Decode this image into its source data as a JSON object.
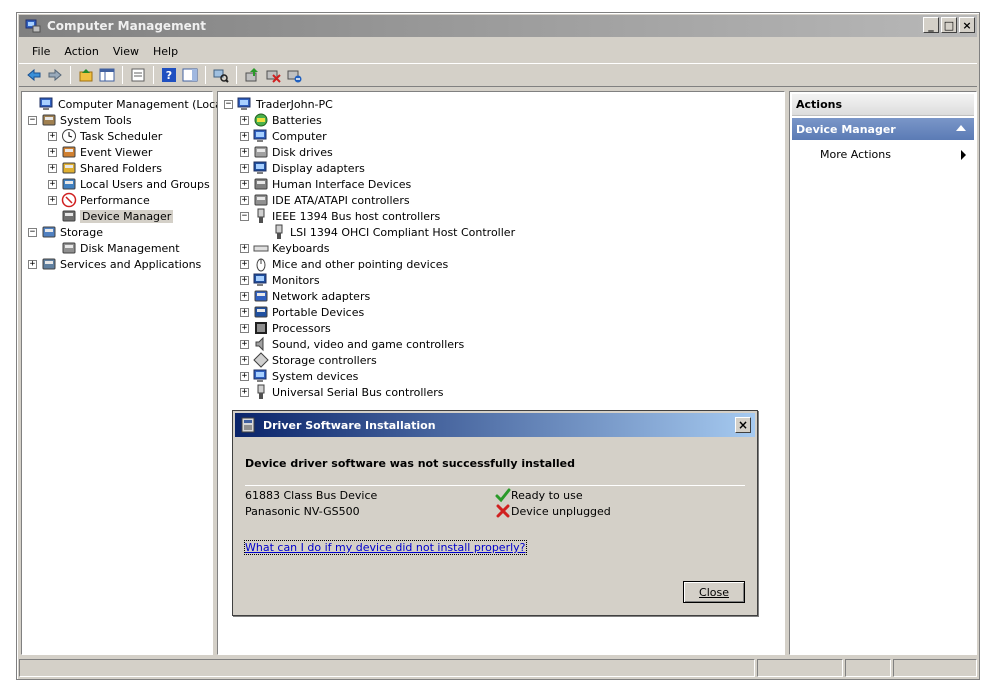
{
  "window": {
    "title": "Computer Management",
    "buttons": {
      "minimize": "_",
      "maximize": "□",
      "close": "×"
    }
  },
  "menu": [
    "File",
    "Action",
    "View",
    "Help"
  ],
  "toolbar": [
    "back-icon",
    "forward-icon",
    "up-icon",
    "show-hide-tree-icon",
    "export-icon",
    "help-icon",
    "action-pane-icon",
    "scan-hardware-icon",
    "update-driver-icon",
    "uninstall-icon",
    "disable-icon"
  ],
  "left_tree": [
    {
      "label": "Computer Management (Local)",
      "indent": 0,
      "expander": "",
      "icon": "computer-mgmt-icon"
    },
    {
      "label": "System Tools",
      "indent": 1,
      "expander": "−",
      "icon": "system-tools-icon"
    },
    {
      "label": "Task Scheduler",
      "indent": 2,
      "expander": "+",
      "icon": "clock-icon"
    },
    {
      "label": "Event Viewer",
      "indent": 2,
      "expander": "+",
      "icon": "event-viewer-icon"
    },
    {
      "label": "Shared Folders",
      "indent": 2,
      "expander": "+",
      "icon": "shared-folder-icon"
    },
    {
      "label": "Local Users and Groups",
      "indent": 2,
      "expander": "+",
      "icon": "users-icon"
    },
    {
      "label": "Performance",
      "indent": 2,
      "expander": "+",
      "icon": "performance-icon"
    },
    {
      "label": "Device Manager",
      "indent": 2,
      "expander": "",
      "icon": "device-manager-icon",
      "selected": true
    },
    {
      "label": "Storage",
      "indent": 1,
      "expander": "−",
      "icon": "storage-icon"
    },
    {
      "label": "Disk Management",
      "indent": 2,
      "expander": "",
      "icon": "disk-icon"
    },
    {
      "label": "Services and Applications",
      "indent": 1,
      "expander": "+",
      "icon": "services-icon"
    }
  ],
  "device_tree": {
    "root": "TraderJohn-PC",
    "categories": [
      {
        "label": "Batteries",
        "expander": "+",
        "icon": "battery-icon"
      },
      {
        "label": "Computer",
        "expander": "+",
        "icon": "computer-icon"
      },
      {
        "label": "Disk drives",
        "expander": "+",
        "icon": "disk-drive-icon"
      },
      {
        "label": "Display adapters",
        "expander": "+",
        "icon": "display-adapter-icon"
      },
      {
        "label": "Human Interface Devices",
        "expander": "+",
        "icon": "hid-icon"
      },
      {
        "label": "IDE ATA/ATAPI controllers",
        "expander": "+",
        "icon": "ide-icon"
      },
      {
        "label": "IEEE 1394 Bus host controllers",
        "expander": "−",
        "icon": "firewire-icon"
      },
      {
        "label": "LSI 1394 OHCI Compliant Host Controller",
        "expander": "",
        "icon": "firewire-icon",
        "child": true
      },
      {
        "label": "Keyboards",
        "expander": "+",
        "icon": "keyboard-icon"
      },
      {
        "label": "Mice and other pointing devices",
        "expander": "+",
        "icon": "mouse-icon"
      },
      {
        "label": "Monitors",
        "expander": "+",
        "icon": "monitor-icon"
      },
      {
        "label": "Network adapters",
        "expander": "+",
        "icon": "network-icon"
      },
      {
        "label": "Portable Devices",
        "expander": "+",
        "icon": "portable-device-icon"
      },
      {
        "label": "Processors",
        "expander": "+",
        "icon": "processor-icon"
      },
      {
        "label": "Sound, video and game controllers",
        "expander": "+",
        "icon": "speaker-icon"
      },
      {
        "label": "Storage controllers",
        "expander": "+",
        "icon": "storage-controller-icon"
      },
      {
        "label": "System devices",
        "expander": "+",
        "icon": "system-device-icon"
      },
      {
        "label": "Universal Serial Bus controllers",
        "expander": "+",
        "icon": "usb-icon"
      }
    ]
  },
  "actions": {
    "header": "Actions",
    "section": "Device Manager",
    "items": [
      "More Actions"
    ]
  },
  "dialog": {
    "title": "Driver Software Installation",
    "heading": "Device driver software was not successfully installed",
    "devices": [
      {
        "name": "61883 Class Bus Device",
        "status": "Ready to use",
        "ok": true
      },
      {
        "name": "Panasonic NV-GS500",
        "status": "Device unplugged",
        "ok": false
      }
    ],
    "link": "What can I do if my device did not install properly?",
    "close_label": "Close",
    "close_glyph": "×"
  }
}
